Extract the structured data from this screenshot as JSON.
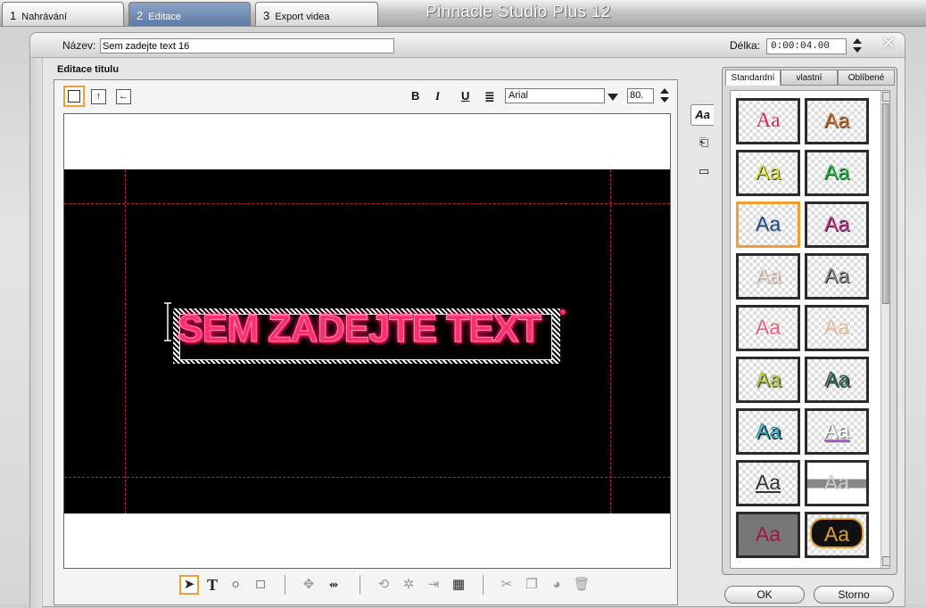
{
  "app": {
    "title": "Pinnacle Studio Plus 12"
  },
  "steps": [
    {
      "num": "1",
      "label": "Nahrávání"
    },
    {
      "num": "2",
      "label": "Editace"
    },
    {
      "num": "3",
      "label": "Export videa"
    }
  ],
  "header": {
    "name_label": "Název:",
    "name_value": "Sem zadejte text 16",
    "duration_label": "Délka:",
    "duration_value": "0:00:04.00",
    "close_icon": "close-icon"
  },
  "editor": {
    "section_title": "Editace titulu",
    "format": {
      "bold": "B",
      "italic": "I",
      "underline": "U",
      "align": "align-justify-icon"
    },
    "font": "Arial",
    "font_size": "80.",
    "title_text": "SEM ZADEJTE TEXT",
    "title_color": "#ff2e6c"
  },
  "bottom_tools": [
    "select-arrow-icon",
    "text-tool-icon",
    "ellipse-tool-icon",
    "rectangle-tool-icon",
    "move-icon",
    "kerning-icon",
    "rotate-icon",
    "skew-icon",
    "align-icon",
    "grid-icon",
    "cut-icon",
    "copy-icon",
    "paste-icon",
    "delete-icon"
  ],
  "gallery": {
    "tabs": [
      {
        "label": "Standardní"
      },
      {
        "label": "vlastní"
      },
      {
        "label": "Oblíbené"
      }
    ],
    "tile_text": "Aa",
    "selected_index": 4
  },
  "buttons": {
    "ok": "OK",
    "cancel": "Storno"
  },
  "colors": {
    "accent_orange": "#f0a030",
    "safe_line": "#c02525"
  }
}
